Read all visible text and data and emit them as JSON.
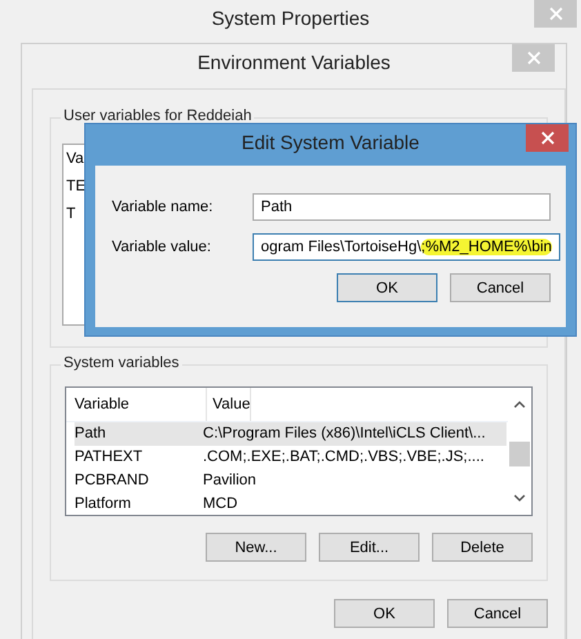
{
  "system_properties": {
    "title": "System Properties"
  },
  "environment_variables": {
    "title": "Environment Variables",
    "user_variables": {
      "label": "User variables for Reddeiah",
      "header_cut": "Va",
      "rows_cut": [
        "TE",
        "T"
      ]
    },
    "system_variables": {
      "label": "System variables",
      "columns": [
        "Variable",
        "Value"
      ],
      "rows": [
        {
          "variable": "Path",
          "value": "C:\\Program Files (x86)\\Intel\\iCLS Client\\...",
          "selected": true
        },
        {
          "variable": "PATHEXT",
          "value": ".COM;.EXE;.BAT;.CMD;.VBS;.VBE;.JS;....",
          "selected": false
        },
        {
          "variable": "PCBRAND",
          "value": "Pavilion",
          "selected": false
        },
        {
          "variable": "Platform",
          "value": "MCD",
          "selected": false
        }
      ],
      "buttons": [
        "New...",
        "Edit...",
        "Delete"
      ]
    },
    "buttons": [
      "OK",
      "Cancel"
    ]
  },
  "edit_dialog": {
    "title": "Edit System Variable",
    "name_label": "Variable name:",
    "name_value": "Path",
    "value_label": "Variable value:",
    "value_parts": [
      {
        "text": "ogram Files\\TortoiseHg\\",
        "highlighted": false
      },
      {
        "text": ";%M2_HOME%\\bin",
        "highlighted": true
      }
    ],
    "buttons": [
      "OK",
      "Cancel"
    ]
  }
}
